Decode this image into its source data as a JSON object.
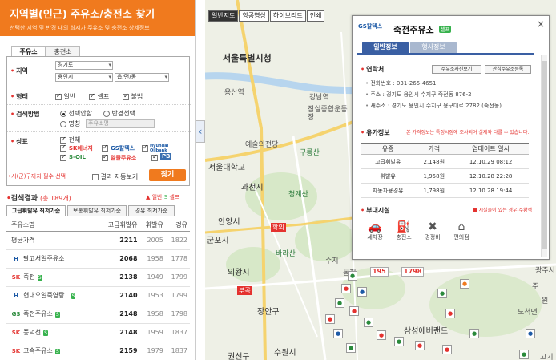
{
  "left_panel": {
    "title": "지역별(인근) 주유소/충전소 찾기",
    "subtitle": "선택한 지역 및 반경 내의 최저가 주유소 및 충전소 상세정보",
    "tabs": [
      "주유소",
      "충전소"
    ],
    "region_label": "지역",
    "region_sido": "경기도",
    "region_sigungu": "용인시",
    "region_dong": "읍/면/동",
    "type_label": "형태",
    "type_options": [
      "일반",
      "셀프",
      "불법"
    ],
    "method_label": "검색방법",
    "method_options": [
      "선택안함",
      "반경선택",
      "명칭"
    ],
    "name_placeholder": "주유소명",
    "brand_label": "상표",
    "brand_all": "전체",
    "brands": [
      "SK에너지",
      "GS칼텍스",
      "Hyundai Oilbank",
      "S-OIL",
      "알뜰주유소",
      "PB"
    ],
    "required_note": "•시(군)구까지 필수 선택",
    "auto_view_label": "결과 자동보기",
    "find_button": "찾기",
    "result_title": "검색결과",
    "result_count": "(총 189개)",
    "legend_general": "일반",
    "legend_self": "셀프",
    "result_tabs": [
      "고급휘발유 최저가순",
      "보통휘발유 최저가순",
      "경유 최저가순"
    ],
    "columns": [
      "주유소명",
      "고급휘발유",
      "휘발유",
      "경유"
    ],
    "avg_row": {
      "name": "평균가격",
      "p1": "2211",
      "p2": "2005",
      "p3": "1822"
    },
    "rows": [
      {
        "logo": "H",
        "name": "팔고서일주유소",
        "self": "",
        "p1": "2068",
        "p2": "1958",
        "p3": "1778"
      },
      {
        "logo": "SK",
        "name": "죽전",
        "self": "S",
        "p1": "2138",
        "p2": "1949",
        "p3": "1799"
      },
      {
        "logo": "H",
        "name": "현대오일죽영랑..",
        "self": "S",
        "p1": "2140",
        "p2": "1953",
        "p3": "1799"
      },
      {
        "logo": "GS",
        "name": "죽전주유소",
        "self": "S",
        "p1": "2148",
        "p2": "1958",
        "p3": "1798"
      },
      {
        "logo": "SK",
        "name": "풍덕천",
        "self": "S",
        "p1": "2148",
        "p2": "1959",
        "p3": "1837"
      },
      {
        "logo": "SK",
        "name": "고속주유소",
        "self": "S",
        "p1": "2159",
        "p2": "1979",
        "p3": "1837"
      }
    ],
    "collapse_icon": "‹"
  },
  "map": {
    "types": [
      "일반지도",
      "항공영상",
      "하이브리드",
      "인쇄"
    ],
    "labels": [
      "서울특별시청",
      "용산역",
      "강남역",
      "잠실종합운동장",
      "예술의전당",
      "구룡산",
      "서울대학교",
      "과천시",
      "청계산",
      "안양시",
      "군포시",
      "의왕시",
      "학의",
      "바라산",
      "수지",
      "동천",
      "부곡",
      "장안구",
      "수원시",
      "권선구",
      "삼성에버랜드",
      "도척면",
      "광주시",
      "주",
      "원",
      "고기"
    ],
    "price_labels": [
      "195",
      "1798"
    ]
  },
  "popup": {
    "brand": "GS칼텍스",
    "title": "죽전주유소",
    "self_badge": "셀프",
    "close": "×",
    "tabs": [
      "일반정보",
      "행사정보"
    ],
    "contact_label": "연락처",
    "photo_button": "주유소사진보기",
    "fav_button": "관심주유소등록",
    "phone": "전화번호 : 031-265-4651",
    "address": "주소 : 경기도 용인시 수지구 죽전동 876-2",
    "new_address": "새주소 : 경기도 용인시 수지구 용구대로 2782 (죽전동)",
    "price_label": "유가정보",
    "price_note": "본 가격정보는 특정시점에 조사되어 실제와 다를 수 있습니다.",
    "price_columns": [
      "유종",
      "가격",
      "업데이트 일시"
    ],
    "price_rows": [
      {
        "fuel": "고급휘발유",
        "price": "2,148원",
        "date": "12.10.29 08:12"
      },
      {
        "fuel": "휘발유",
        "price": "1,958원",
        "date": "12.10.28 22:28"
      },
      {
        "fuel": "자동차용경유",
        "price": "1,798원",
        "date": "12.10.28 19:44"
      }
    ],
    "facility_label": "부대시설",
    "facility_note": "■ 시설물이 있는 경우 주황색",
    "facilities": [
      "세차장",
      "충전소",
      "경정비",
      "편의점"
    ]
  }
}
